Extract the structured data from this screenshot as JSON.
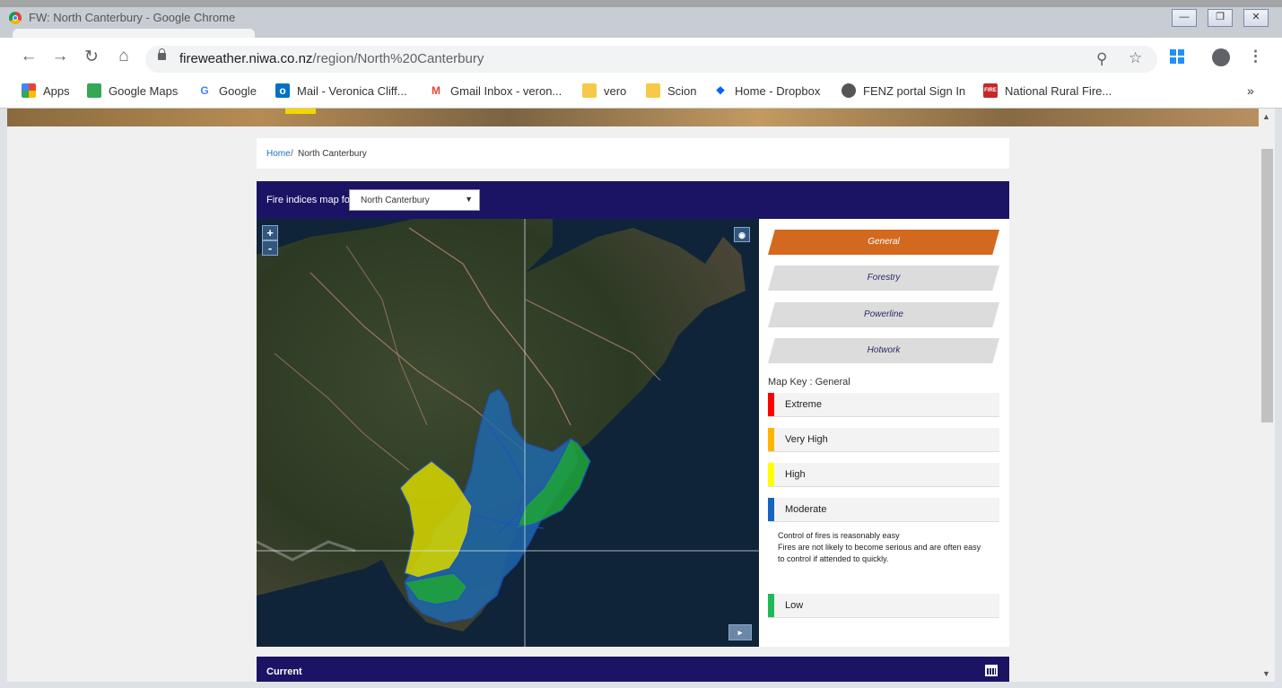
{
  "window": {
    "title": "FW: North Canterbury - Google Chrome"
  },
  "toolbar": {
    "url_host": "fireweather.niwa.co.nz",
    "url_path": "/region/North%20Canterbury"
  },
  "bookmarks": [
    {
      "label": "Apps",
      "icon": "apps-grid-icon"
    },
    {
      "label": "Google Maps",
      "icon": "google-maps-icon"
    },
    {
      "label": "Google",
      "icon": "google-icon"
    },
    {
      "label": "Mail - Veronica Cliff...",
      "icon": "outlook-icon"
    },
    {
      "label": "Gmail Inbox - veron...",
      "icon": "gmail-icon"
    },
    {
      "label": "vero",
      "icon": "folder-icon"
    },
    {
      "label": "Scion",
      "icon": "folder-icon"
    },
    {
      "label": "Home - Dropbox",
      "icon": "dropbox-icon"
    },
    {
      "label": "FENZ portal Sign In",
      "icon": "globe-icon"
    },
    {
      "label": "National Rural Fire...",
      "icon": "fire-logo-icon"
    }
  ],
  "breadcrumb": {
    "home": "Home",
    "separator": "/",
    "current": "North Canterbury"
  },
  "map_panel": {
    "label": "Fire indices map for",
    "region_selected": "North Canterbury",
    "zoom_in": "+",
    "zoom_out": "-"
  },
  "index_tabs": [
    {
      "label": "General",
      "active": true
    },
    {
      "label": "Forestry",
      "active": false
    },
    {
      "label": "Powerline",
      "active": false
    },
    {
      "label": "Hotwork",
      "active": false
    }
  ],
  "map_key": {
    "title": "Map Key : General",
    "levels": [
      {
        "label": "Extreme",
        "color": "#ff0000"
      },
      {
        "label": "Very High",
        "color": "#ffb400"
      },
      {
        "label": "High",
        "color": "#ffff00"
      },
      {
        "label": "Moderate",
        "color": "#1565c0"
      },
      {
        "label": "Low",
        "color": "#1db954"
      }
    ],
    "description": [
      "Control of fires is reasonably easy",
      "Fires are not likely to become serious and are often easy",
      "to control if attended to quickly."
    ]
  },
  "current_section": {
    "title": "Current"
  },
  "colors": {
    "header_navy": "#1b1464",
    "active_tab": "#d2691e",
    "inactive_tab": "#dcdcdc"
  }
}
